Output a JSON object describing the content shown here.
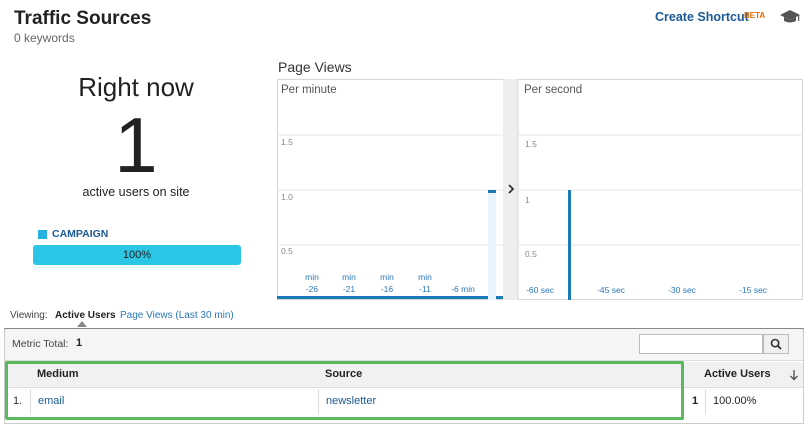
{
  "header": {
    "title": "Traffic Sources",
    "subtitle": "0 keywords",
    "shortcut_label": "Create Shortcut",
    "beta_label": "BETA",
    "cap_icon": "graduation-cap-icon"
  },
  "summary": {
    "heading": "Right now",
    "count": "1",
    "caption": "active users on site",
    "legend_label": "CAMPAIGN",
    "legend_color": "#24b3e0",
    "bar_percent_label": "100%",
    "bar_fraction": 1.0
  },
  "pageviews_chart": {
    "title": "Page Views",
    "panels": [
      {
        "label": "Per minute",
        "y_ticks": [
          "1.5",
          "1.0",
          "0.5"
        ],
        "x_ticks": [
          {
            "unit": "min",
            "value": "-26"
          },
          {
            "unit": "min",
            "value": "-21"
          },
          {
            "unit": "min",
            "value": "-16"
          },
          {
            "unit": "min",
            "value": "-11"
          },
          {
            "unit": "",
            "value": "-6 min"
          }
        ],
        "bar_value": 1,
        "ylim": [
          0,
          2
        ]
      },
      {
        "label": "Per second",
        "y_ticks": [
          "1.5",
          "1",
          "0.5"
        ],
        "x_ticks": [
          "-60 sec",
          "-45 sec",
          "-30 sec",
          "-15 sec"
        ],
        "bar_value": 1,
        "ylim": [
          0,
          2
        ]
      }
    ],
    "bar_color": "#1a7ab9"
  },
  "viewing": {
    "label": "Viewing:",
    "active_tab": "Active Users",
    "other_tab": "Page Views (Last 30 min)"
  },
  "table": {
    "metric_label": "Metric Total:",
    "metric_value": "1",
    "search_placeholder": "",
    "search_icon": "magnifier-icon",
    "columns": [
      "Medium",
      "Source",
      "Active Users"
    ],
    "rows": [
      {
        "num": "1.",
        "medium": "email",
        "source": "newsletter",
        "users": "1",
        "percent": "100.00%"
      }
    ],
    "highlight_color": "#5cb85c"
  }
}
